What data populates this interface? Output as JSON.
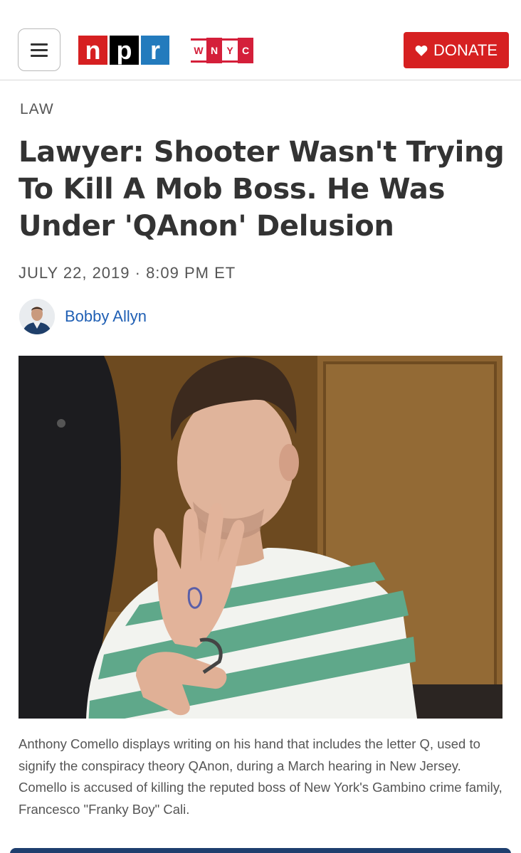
{
  "header": {
    "npr_letters": [
      "n",
      "p",
      "r"
    ],
    "wnyc_letters": [
      "W",
      "N",
      "Y",
      "C"
    ],
    "donate_label": "DONATE",
    "icons": {
      "menu": "hamburger-menu-icon",
      "donate": "heart-icon"
    },
    "colors": {
      "npr_red": "#d62021",
      "npr_black": "#000000",
      "npr_blue": "#237bbd",
      "wnyc_red": "#d41f3a",
      "donate_bg": "#d62021"
    }
  },
  "article": {
    "section": "LAW",
    "headline": "Lawyer: Shooter Wasn't Trying To Kill A Mob Boss. He Was Under 'QAnon' Delusion",
    "date": "JULY 22, 2019 · 8:09 PM ET",
    "author": "Bobby Allyn",
    "caption": "Anthony Comello displays writing on his hand that includes the letter Q, used to signify the conspiracy theory QAnon, during a March hearing in New Jersey. Comello is accused of killing the reputed boss of New York's Gambino crime family, Francesco \"Franky Boy\" Cali."
  }
}
